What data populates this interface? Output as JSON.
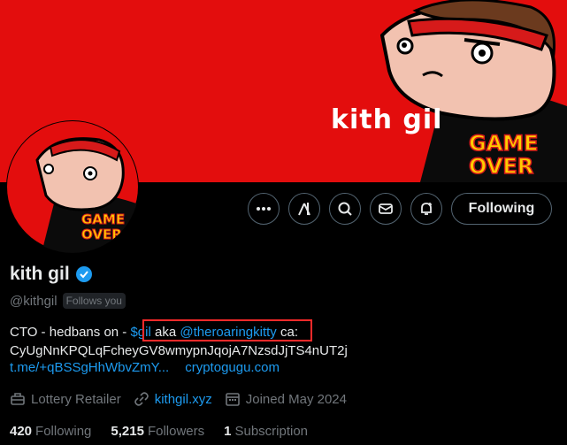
{
  "banner": {
    "text": "kith gil",
    "badge": "GAME OVER"
  },
  "avatar": {
    "badge": "GAME OVER"
  },
  "actions": {
    "more_icon": "more-horizontal-icon",
    "grok_icon": "grok-icon",
    "search_icon": "search-icon",
    "message_icon": "envelope-icon",
    "notify_icon": "bell-plus-icon",
    "following_label": "Following"
  },
  "profile": {
    "name": "kith gil",
    "verified": true,
    "handle": "@kithgil",
    "follows_you": "Follows you"
  },
  "bio": {
    "line1_prefix": "CTO - hedbans on - ",
    "cashtag": "$gil",
    "aka": " aka ",
    "mention": "@theroaringkitty",
    "line1_suffix": " ca:",
    "line2": "CyUgNnKPQLqFcheyGV8wmypnJqojA7NzsdJjTS4nUT2j",
    "link1": "t.me/+qBSSgHhWbvZmY...",
    "link2": "cryptogugu.com"
  },
  "meta": {
    "category": "Lottery Retailer",
    "website": "kithgil.xyz",
    "joined": "Joined May 2024"
  },
  "stats": {
    "following_count": "420",
    "following_label": "Following",
    "followers_count": "5,215",
    "followers_label": "Followers",
    "subscription_count": "1",
    "subscription_label": "Subscription"
  },
  "colors": {
    "accent": "#1d9bf0",
    "banner": "#e30d0d",
    "highlight": "#ff2a2a"
  }
}
